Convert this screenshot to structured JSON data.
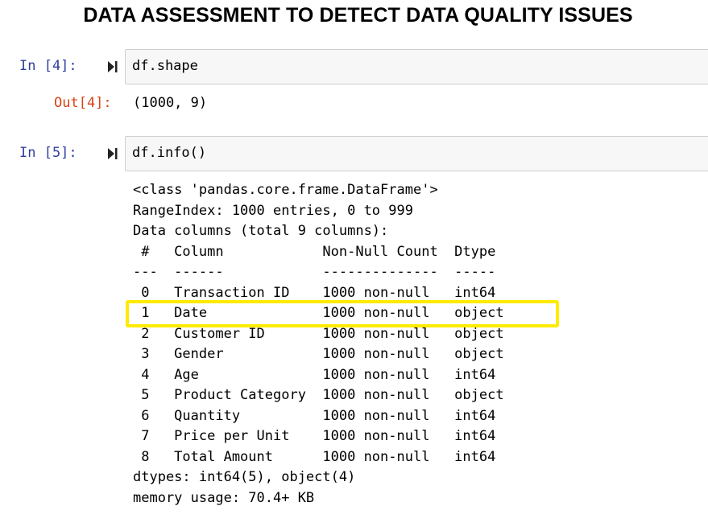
{
  "heading": "DATA ASSESSMENT TO DETECT DATA QUALITY ISSUES",
  "cells": [
    {
      "in_prompt": "In [4]:",
      "code": "df.shape",
      "out_prompt": "Out[4]:",
      "output": "(1000, 9)"
    },
    {
      "in_prompt": "In [5]:",
      "code": "df.info()"
    }
  ],
  "info": {
    "class_line": "<class 'pandas.core.frame.DataFrame'>",
    "range_index": "RangeIndex: 1000 entries, 0 to 999",
    "data_columns": "Data columns (total 9 columns):",
    "header": " #   Column            Non-Null Count  Dtype ",
    "separator": "---  ------            --------------  ----- ",
    "rows": [
      " 0   Transaction ID    1000 non-null   int64 ",
      " 1   Date              1000 non-null   object",
      " 2   Customer ID       1000 non-null   object",
      " 3   Gender            1000 non-null   object",
      " 4   Age               1000 non-null   int64 ",
      " 5   Product Category  1000 non-null   object",
      " 6   Quantity          1000 non-null   int64 ",
      " 7   Price per Unit    1000 non-null   int64 ",
      " 8   Total Amount      1000 non-null   int64 "
    ],
    "dtypes": "dtypes: int64(5), object(4)",
    "memory": "memory usage: 70.4+ KB"
  },
  "highlight": {
    "color": "#ffea00",
    "row_label": "Date"
  },
  "colors": {
    "in_prompt": "#303f9f",
    "out_prompt": "#d84315",
    "cell_bg": "#f7f7f7"
  },
  "icons": {
    "run": "run-cell-icon"
  }
}
